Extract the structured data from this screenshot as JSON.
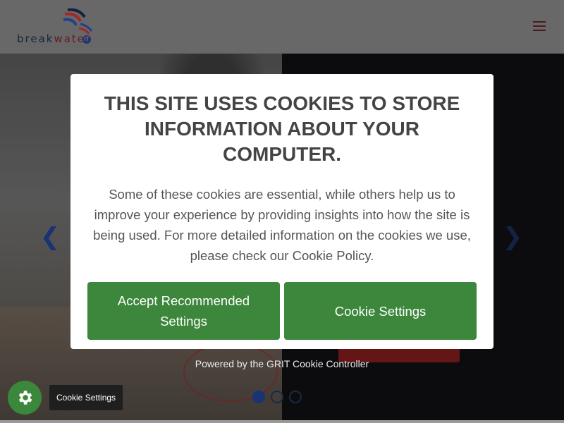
{
  "header": {
    "logo_text_a": "break",
    "logo_text_b": "water",
    "logo_badge": "IT",
    "menu_icon": "hamburger-menu-icon"
  },
  "hero": {
    "prev_icon": "chevron-left-icon",
    "next_icon": "chevron-right-icon",
    "prev_glyph": "❮",
    "next_glyph": "❯",
    "slides": 3,
    "active_slide": 1
  },
  "cookie_modal": {
    "title": "THIS SITE USES COOKIES TO STORE INFORMATION ABOUT YOUR COMPUTER.",
    "body": "Some of these cookies are essential, while others help us to improve your experience by providing insights into how the site is being used. For more detailed information on the cookies we use, please check our Cookie Policy.",
    "accept_label": "Accept Recommended Settings",
    "settings_label": "Cookie Settings",
    "powered_by": "Powered by the GRIT Cookie Controller"
  },
  "cookie_fab": {
    "icon": "gear-icon",
    "tooltip": "Cookie Settings"
  },
  "colors": {
    "accent_green": "#3c873b",
    "header_bg": "#7f7f7f",
    "arrow_blue": "#1f3f8f"
  }
}
